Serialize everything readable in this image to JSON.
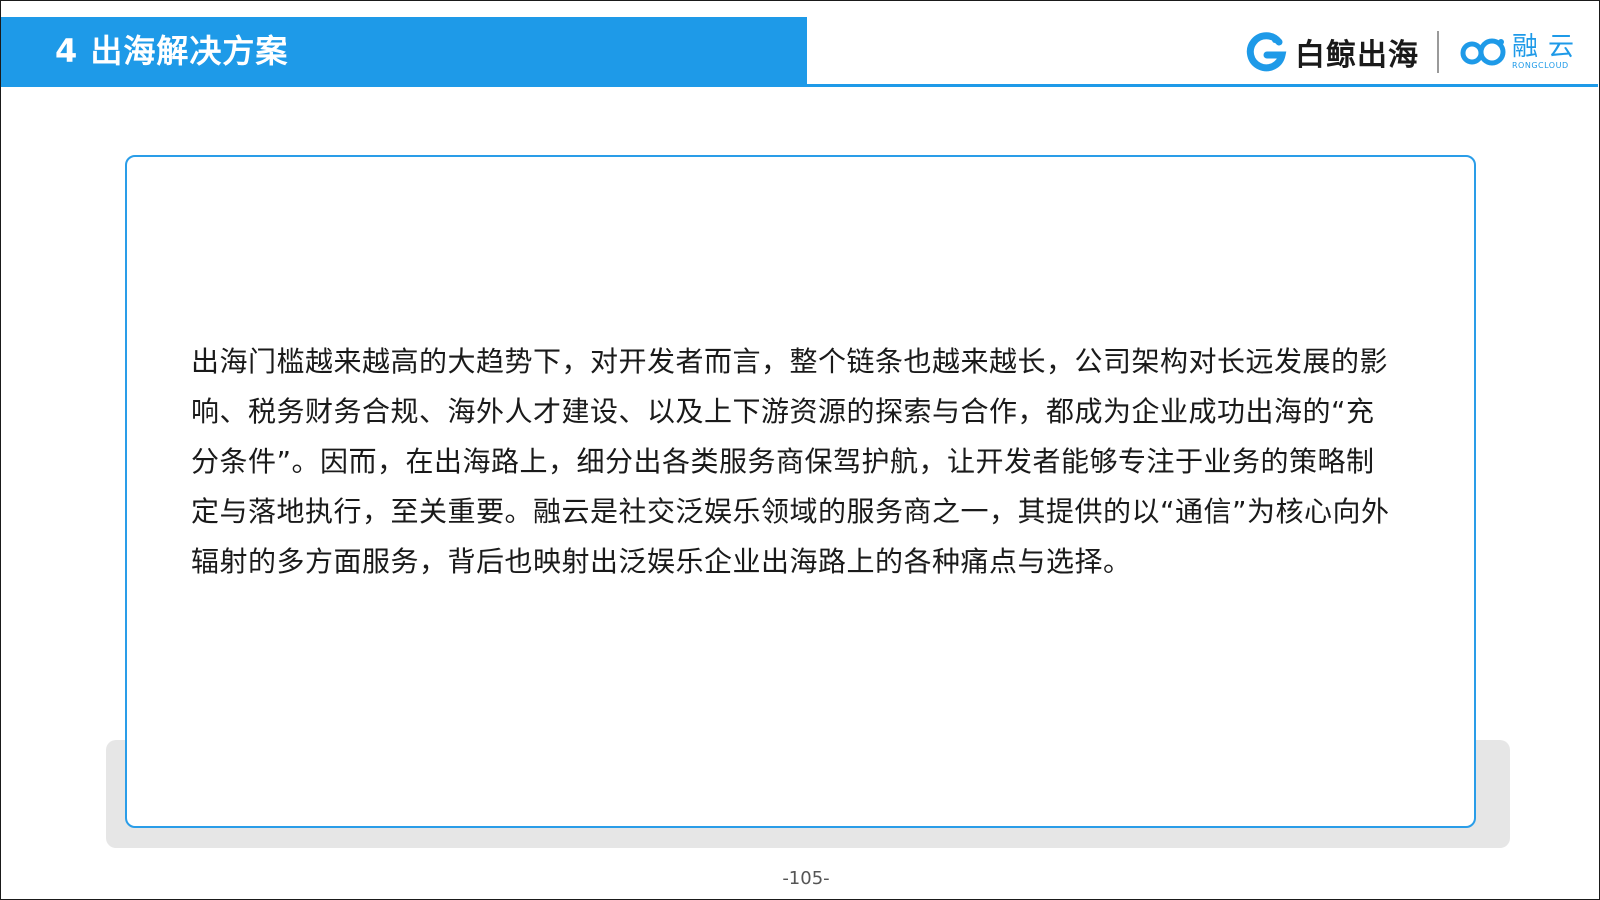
{
  "header": {
    "title": "4 出海解决方案"
  },
  "logos": {
    "baijing": {
      "icon": "baijing-g-icon",
      "text": "白鲸出海"
    },
    "rongcloud": {
      "icon": "rongcloud-infinity-icon",
      "text_cn": "融云",
      "text_en": "RONGCLOUD"
    }
  },
  "content": {
    "paragraph": "出海门槛越来越高的大趋势下，对开发者而言，整个链条也越来越长，公司架构对长远发展的影响、税务财务合规、海外人才建设、以及上下游资源的探索与合作，都成为企业成功出海的“充分条件”。因而，在出海路上，细分出各类服务商保驾护航，让开发者能够专注于业务的策略制定与落地执行，至关重要。融云是社交泛娱乐领域的服务商之一，其提供的以“通信”为核心向外辐射的多方面服务，背后也映射出泛娱乐企业出海路上的各种痛点与选择。"
  },
  "footer": {
    "page_number": "-105-"
  },
  "colors": {
    "accent": "#1e9ae8",
    "card_border": "#2a9de8",
    "shadow_panel": "#e6e6e6",
    "text": "#1a1a1a"
  }
}
